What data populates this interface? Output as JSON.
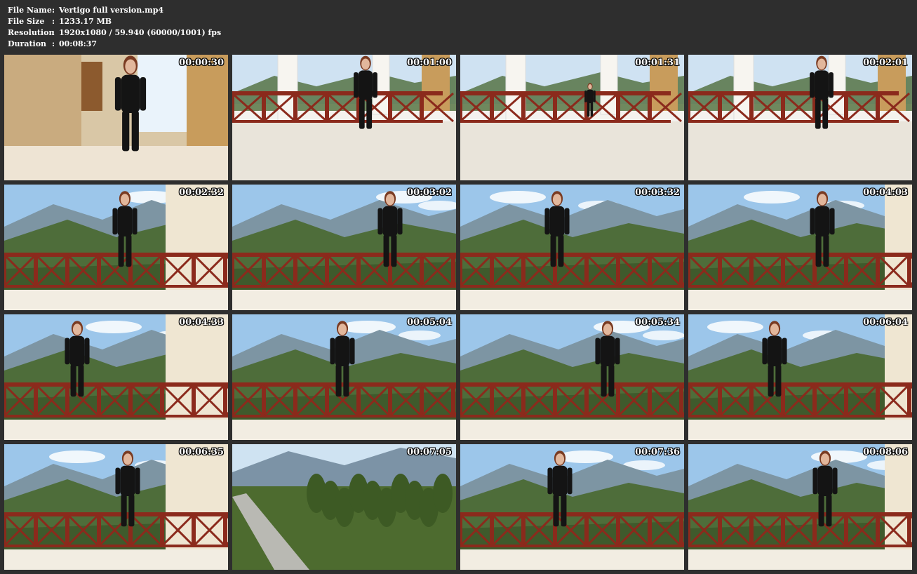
{
  "metadata": {
    "file_name_label": "File Name",
    "file_name": "Vertigo full version.mp4",
    "file_size_label": "File Size",
    "file_size": "1233.17 MB",
    "resolution_label": "Resolution",
    "resolution": "1920x1080 / 59.940 (60000/1001) fps",
    "duration_label": "Duration",
    "duration": "00:08:37",
    "separator": ":"
  },
  "thumbnails": [
    {
      "timestamp": "00:00:30",
      "scene": "interior"
    },
    {
      "timestamp": "00:01:00",
      "scene": "colonnade"
    },
    {
      "timestamp": "00:01:31",
      "scene": "colonnade-far"
    },
    {
      "timestamp": "00:02:01",
      "scene": "colonnade"
    },
    {
      "timestamp": "00:02:32",
      "scene": "balcony-mountain"
    },
    {
      "timestamp": "00:03:02",
      "scene": "balcony-mountain"
    },
    {
      "timestamp": "00:03:32",
      "scene": "balcony-mountain"
    },
    {
      "timestamp": "00:04:03",
      "scene": "balcony-mountain"
    },
    {
      "timestamp": "00:04:33",
      "scene": "balcony-mountain"
    },
    {
      "timestamp": "00:05:04",
      "scene": "balcony-mountain"
    },
    {
      "timestamp": "00:05:34",
      "scene": "balcony-mountain"
    },
    {
      "timestamp": "00:06:04",
      "scene": "balcony-mountain"
    },
    {
      "timestamp": "00:06:35",
      "scene": "balcony-mountain"
    },
    {
      "timestamp": "00:07:05",
      "scene": "forest-road"
    },
    {
      "timestamp": "00:07:36",
      "scene": "balcony-mountain"
    },
    {
      "timestamp": "00:08:06",
      "scene": "balcony-mountain"
    }
  ],
  "colors": {
    "background": "#2e2e2e",
    "text": "#ffffff",
    "railing": "#8b2a1c",
    "sky": "#9cc6ea",
    "mountain": "#4e6d3a",
    "wall": "#e8dcc4",
    "figure": "#141414"
  }
}
